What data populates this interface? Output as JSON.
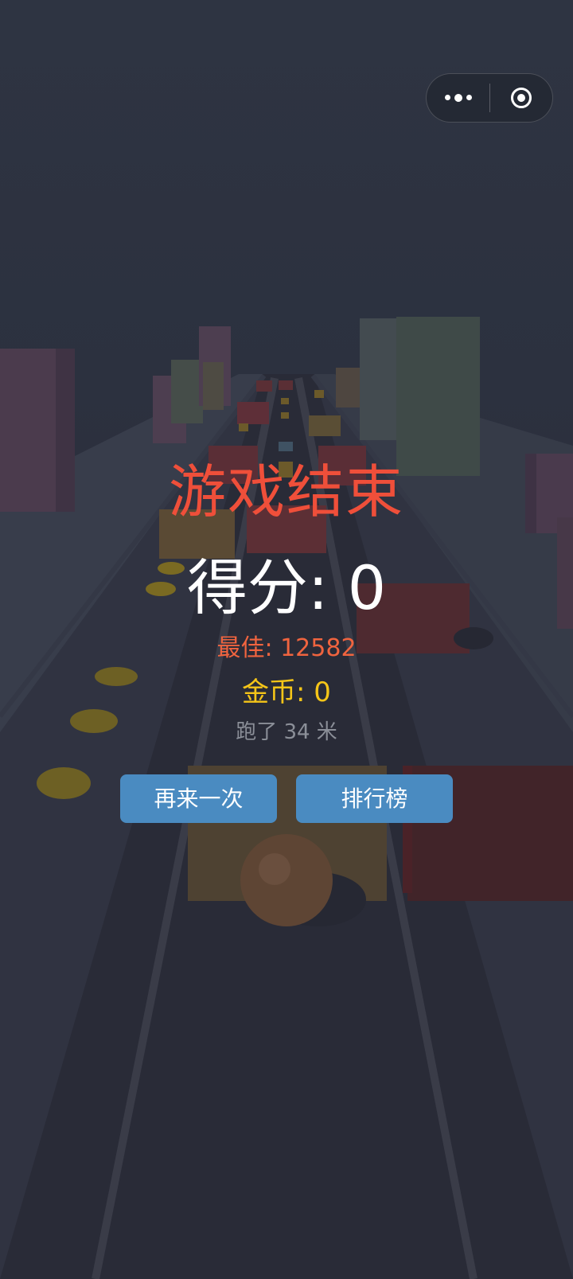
{
  "game_over": {
    "title": "游戏结束",
    "score_label": "得分: 0",
    "score": 0,
    "best_label": "最佳: 12582",
    "best": 12582,
    "coins_label": "金币: 0",
    "coins": 0,
    "distance_label": "跑了 34 米",
    "distance_m": 34,
    "retry_button": "再来一次",
    "leaderboard_button": "排行榜"
  },
  "capsule": {
    "more_icon": "more-dots-icon",
    "close_icon": "target-circle-icon"
  },
  "colors": {
    "title": "#ef4f3a",
    "best": "#f0643f",
    "coins": "#f5c518",
    "distance": "#8b8f98",
    "button": "#4a8bc1",
    "background": "#2b2f3d"
  }
}
